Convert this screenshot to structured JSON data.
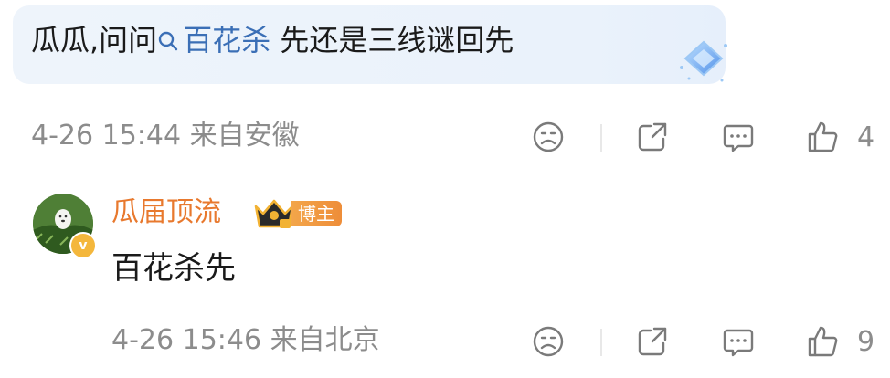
{
  "comment": {
    "text_before": "瓜瓜,问问",
    "topic": "百花杀",
    "text_after": " 先还是三线谜回先",
    "meta": "4-26 15:44 来自安徽",
    "like_count": "4"
  },
  "reply": {
    "author": "瓜届顶流",
    "badge": "博主",
    "text": "百花杀先",
    "meta": "4-26 15:46 来自北京",
    "like_count": "9"
  },
  "icons": [
    "search-icon",
    "gem-icon",
    "dislike-icon",
    "share-icon",
    "comment-icon",
    "like-icon",
    "crown-icon",
    "verified-icon"
  ],
  "colors": {
    "topic_link": "#3b6fb6",
    "author": "#e8792e",
    "badge": "#ef8f3b",
    "meta": "#8c8c8c",
    "bubble": "#eef4fb"
  }
}
